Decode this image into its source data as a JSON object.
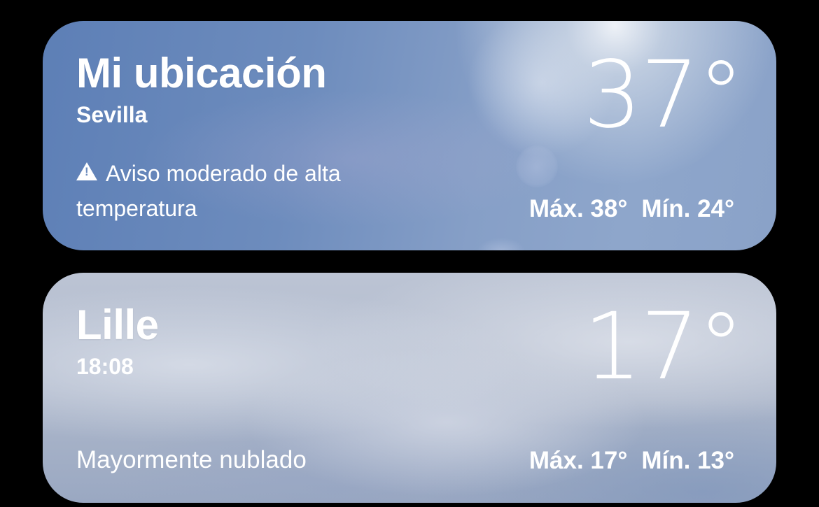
{
  "cards": [
    {
      "title": "Mi ubicación",
      "subtitle": "Sevilla",
      "temperature": "37°",
      "alert": "Aviso moderado de alta temperatura",
      "alert_icon": "warning-triangle-icon",
      "high": "Máx. 38°",
      "low": "Mín. 24°",
      "background": "#6d8cbd"
    },
    {
      "title": "Lille",
      "subtitle": "18:08",
      "temperature": "17°",
      "condition": "Mayormente nublado",
      "high": "Máx. 17°",
      "low": "Mín. 13°",
      "background": "#aeb8cb"
    }
  ]
}
